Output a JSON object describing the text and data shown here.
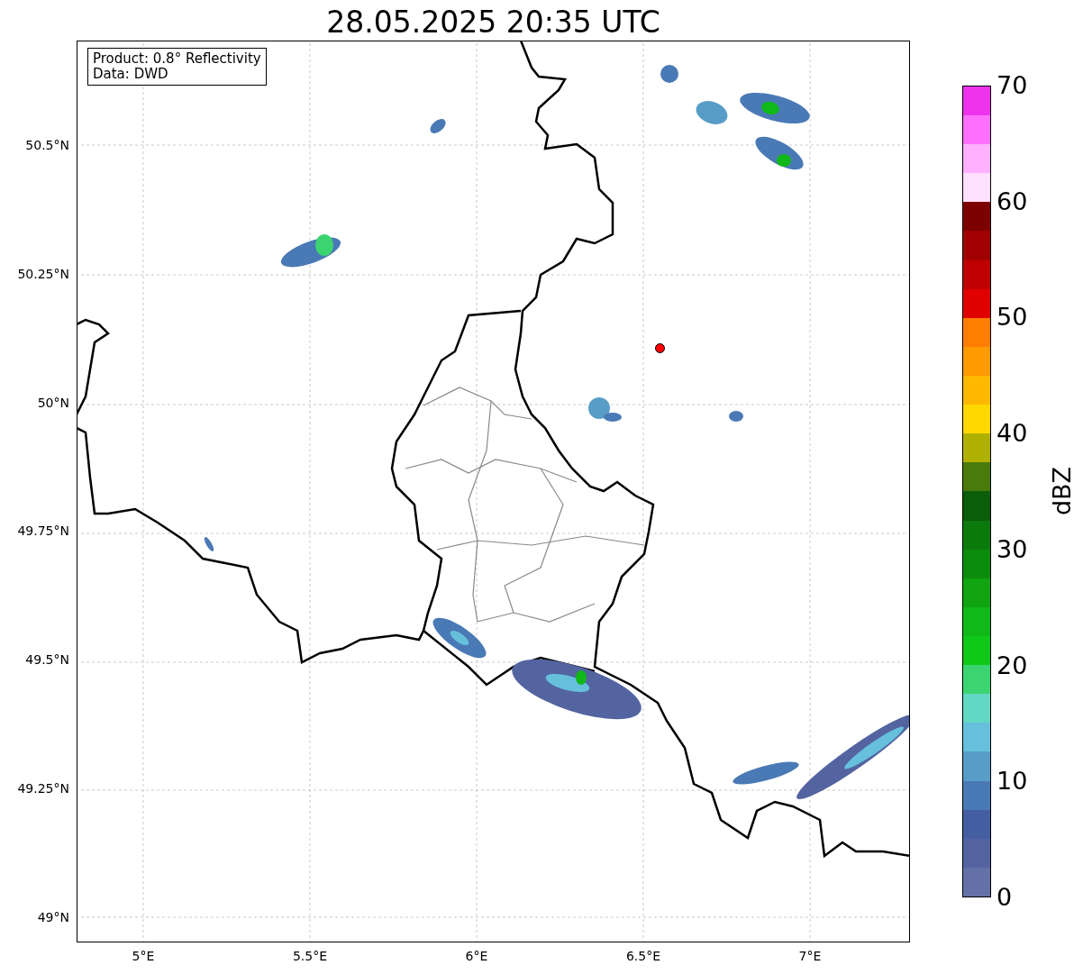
{
  "title": "28.05.2025 20:35 UTC",
  "info_box": [
    "Product: 0.8° Reflectivity",
    "Data: DWD"
  ],
  "y_tick_labels": [
    "50.5°N",
    "50.25°N",
    "50°N",
    "49.75°N",
    "49.5°N",
    "49.25°N",
    "49°N"
  ],
  "x_tick_labels": [
    "5°E",
    "5.5°E",
    "6°E",
    "6.5°E",
    "7°E"
  ],
  "colorbar": {
    "label": "dBZ",
    "ticks": [
      "70",
      "60",
      "50",
      "40",
      "30",
      "20",
      "10",
      "0"
    ],
    "bands": [
      {
        "color": "#6371a6"
      },
      {
        "color": "#5364a0"
      },
      {
        "color": "#445ea2"
      },
      {
        "color": "#4a7ab5"
      },
      {
        "color": "#589cc8"
      },
      {
        "color": "#66c0dc"
      },
      {
        "color": "#62d8c4"
      },
      {
        "color": "#3cd470"
      },
      {
        "color": "#10c818"
      },
      {
        "color": "#10b818"
      },
      {
        "color": "#10a410"
      },
      {
        "color": "#0c8c0c"
      },
      {
        "color": "#0a7a0c"
      },
      {
        "color": "#0a5e0a"
      },
      {
        "color": "#4a7a0a"
      },
      {
        "color": "#b0b000"
      },
      {
        "color": "#ffd800"
      },
      {
        "color": "#ffb800"
      },
      {
        "color": "#ff9a00"
      },
      {
        "color": "#ff7e00"
      },
      {
        "color": "#e00000"
      },
      {
        "color": "#c00000"
      },
      {
        "color": "#a00000"
      },
      {
        "color": "#7c0000"
      },
      {
        "color": "#ffe0ff"
      },
      {
        "color": "#ffb0ff"
      },
      {
        "color": "#ff70ff"
      },
      {
        "color": "#ee33ee"
      }
    ]
  }
}
